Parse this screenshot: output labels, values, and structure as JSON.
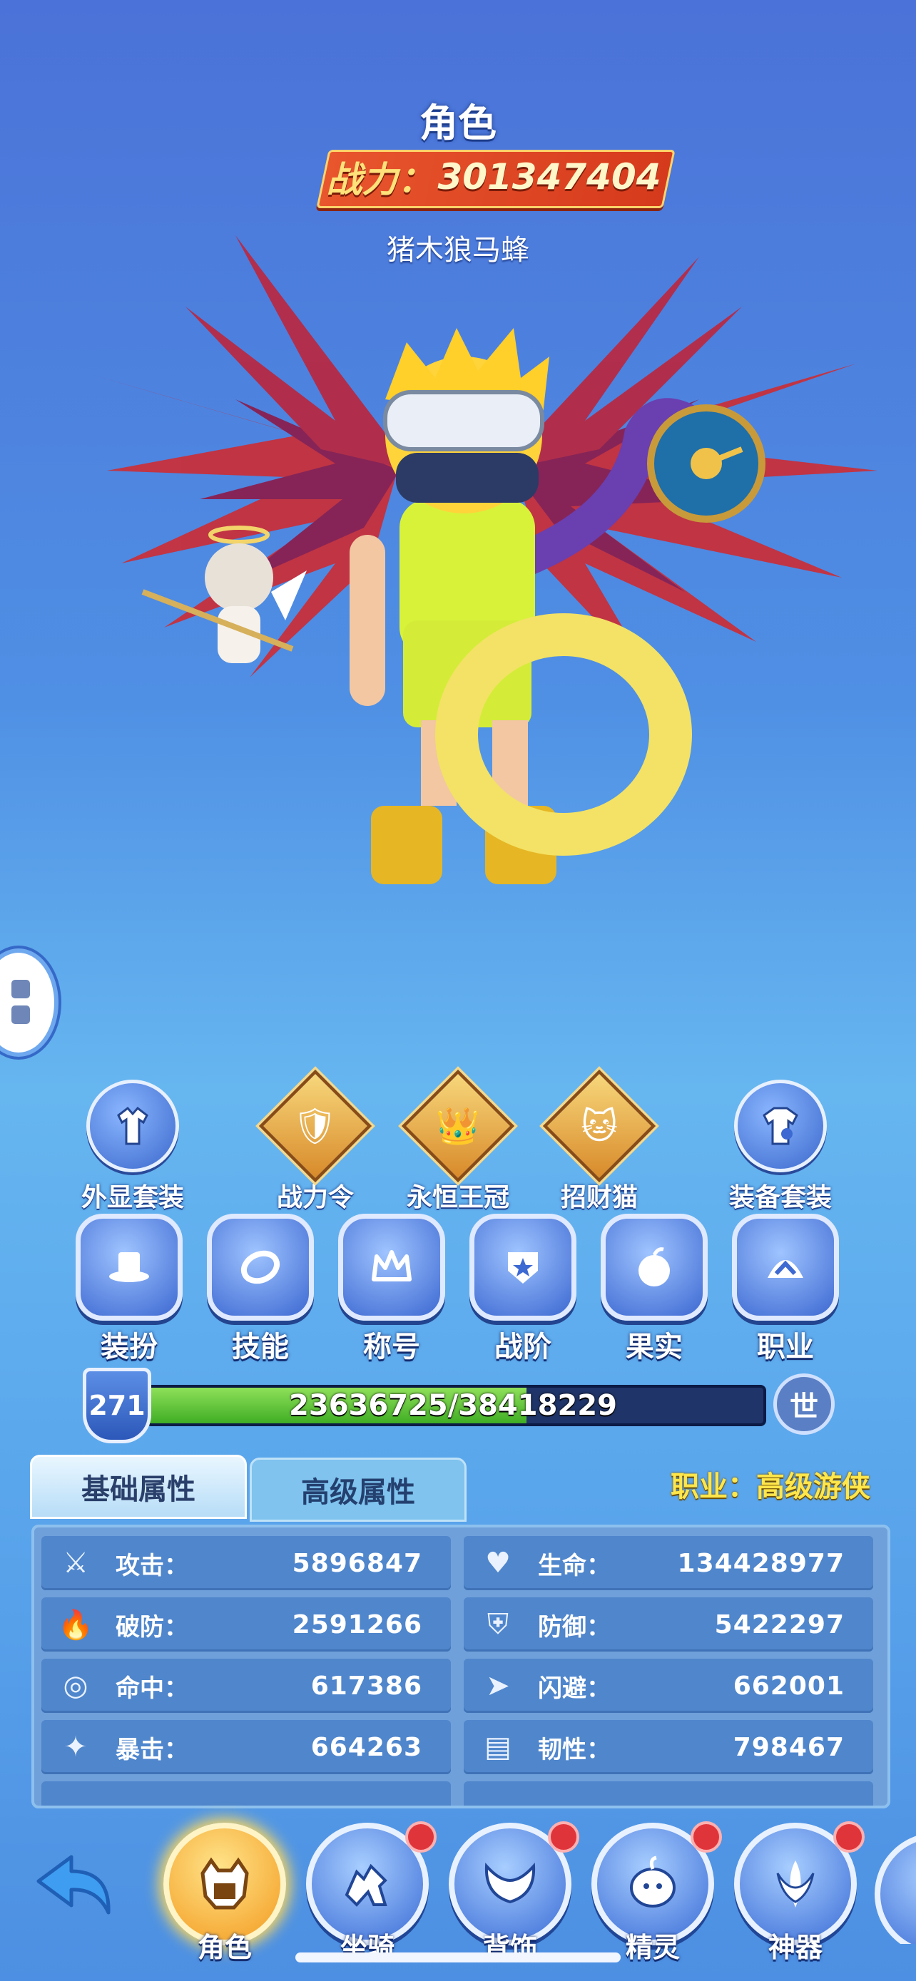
{
  "header": {
    "title": "角色",
    "power_label": "战力：",
    "power_value": "301347404",
    "player_name": "猪木狼马蜂"
  },
  "features": [
    {
      "label": "外显套装",
      "icon": "shirt-icon"
    },
    {
      "label": "战力令",
      "icon": "shield-badge-icon"
    },
    {
      "label": "永恒王冠",
      "icon": "crown-icon"
    },
    {
      "label": "招财猫",
      "icon": "lucky-cat-icon"
    },
    {
      "label": "装备套装",
      "icon": "tshirt-icon"
    }
  ],
  "menu": [
    {
      "label": "装扮",
      "icon": "hat-icon"
    },
    {
      "label": "技能",
      "icon": "ring-icon"
    },
    {
      "label": "称号",
      "icon": "crown-outline-icon"
    },
    {
      "label": "战阶",
      "icon": "star-badge-icon"
    },
    {
      "label": "果实",
      "icon": "fruit-icon"
    },
    {
      "label": "职业",
      "icon": "helmet-icon"
    }
  ],
  "level": {
    "value": "271",
    "xp_text": "23636725/38418229",
    "xp_progress": 0.615,
    "world_button": "世"
  },
  "tabs": {
    "basic": "基础属性",
    "advanced": "高级属性"
  },
  "job_text": "职业：高级游侠",
  "stats": [
    {
      "name": "攻击：",
      "value": "5896847",
      "icon": "sword-icon"
    },
    {
      "name": "生命：",
      "value": "134428977",
      "icon": "heart-icon"
    },
    {
      "name": "破防：",
      "value": "2591266",
      "icon": "flame-icon"
    },
    {
      "name": "防御：",
      "value": "5422297",
      "icon": "shield-icon"
    },
    {
      "name": "命中：",
      "value": "617386",
      "icon": "target-icon"
    },
    {
      "name": "闪避：",
      "value": "662001",
      "icon": "dash-icon"
    },
    {
      "name": "暴击：",
      "value": "664263",
      "icon": "crit-icon"
    },
    {
      "name": "韧性：",
      "value": "798467",
      "icon": "armor-icon"
    }
  ],
  "nav": [
    {
      "label": "角色",
      "icon": "character-icon",
      "active": true,
      "badge": false
    },
    {
      "label": "坐骑",
      "icon": "mount-icon",
      "active": false,
      "badge": true
    },
    {
      "label": "背饰",
      "icon": "wings-icon",
      "active": false,
      "badge": true
    },
    {
      "label": "精灵",
      "icon": "spirit-icon",
      "active": false,
      "badge": true
    },
    {
      "label": "神器",
      "icon": "artifact-icon",
      "active": false,
      "badge": true
    }
  ],
  "colors": {
    "background_top": "#4b72d8",
    "power_banner": "#e8562d",
    "xp_fill": "#3fae24",
    "job_text": "#ffe64a",
    "badge": "#e0343b"
  }
}
